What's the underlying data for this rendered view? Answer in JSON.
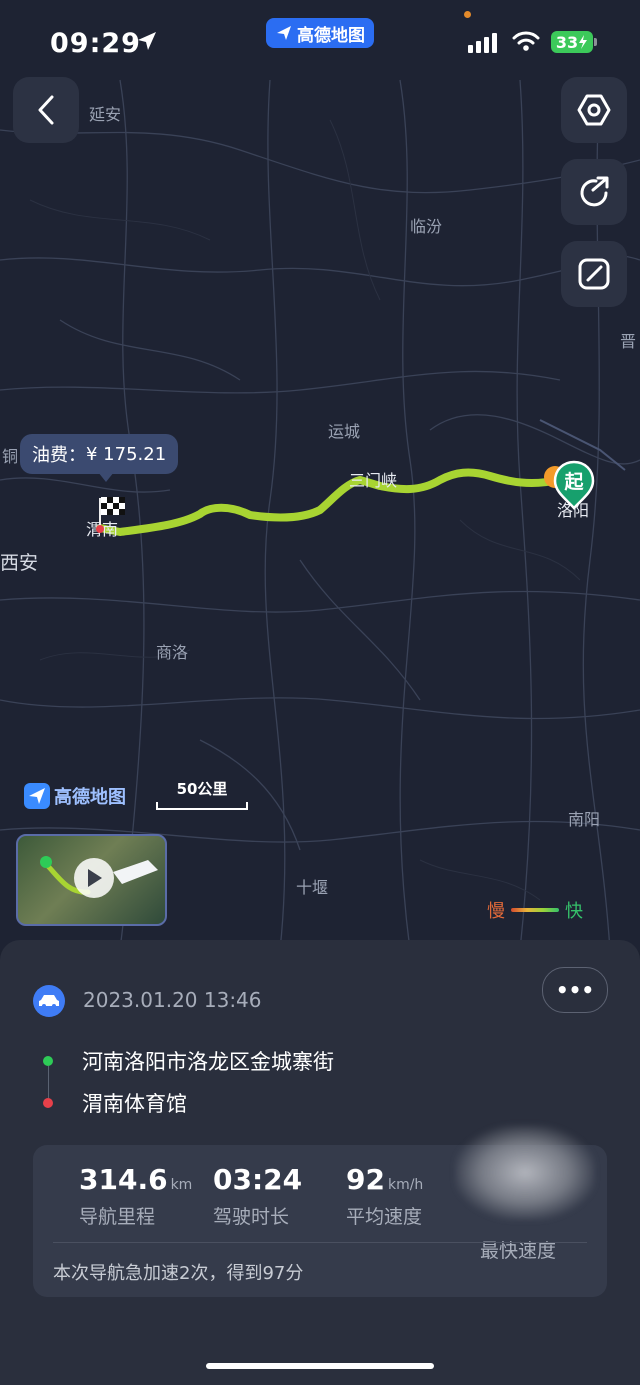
{
  "status": {
    "time": "09:29",
    "app_badge": "高德地图",
    "battery": "33"
  },
  "map": {
    "labels": {
      "yanan": "延安",
      "linfen": "临汾",
      "jin": "晋",
      "tong": "铜",
      "yuncheng": "运城",
      "sanmenxia": "三门峡",
      "luoyang": "洛阳",
      "weinan": "渭南",
      "xian": "西安",
      "shangluo": "商洛",
      "nanyang": "南阳",
      "shiyan": "十堰"
    },
    "fuel_label": "油费：",
    "fuel_value": "¥ 175.21",
    "start_marker": "起",
    "logo_text": "高德地图",
    "scale_label": "50公里",
    "legend_slow": "慢",
    "legend_fast": "快"
  },
  "trip": {
    "datetime": "2023.01.20 13:46",
    "more_label": "•••",
    "origin": "河南洛阳市洛龙区金城寨街",
    "destination": "渭南体育馆",
    "stats": [
      {
        "value": "314.6",
        "unit": "km",
        "label": "导航里程"
      },
      {
        "value": "03:24",
        "unit": "",
        "label": "驾驶时长"
      },
      {
        "value": "92",
        "unit": "km/h",
        "label": "平均速度"
      },
      {
        "value": "",
        "unit": "",
        "label": "最快速度"
      }
    ],
    "summary": "本次导航急加速2次，得到97分"
  },
  "colors": {
    "route": "#a8d432",
    "button_bg": "#2c3243",
    "accent": "#3f7cf5",
    "origin_dot": "#2ecb57",
    "dest_dot": "#e7404a"
  }
}
